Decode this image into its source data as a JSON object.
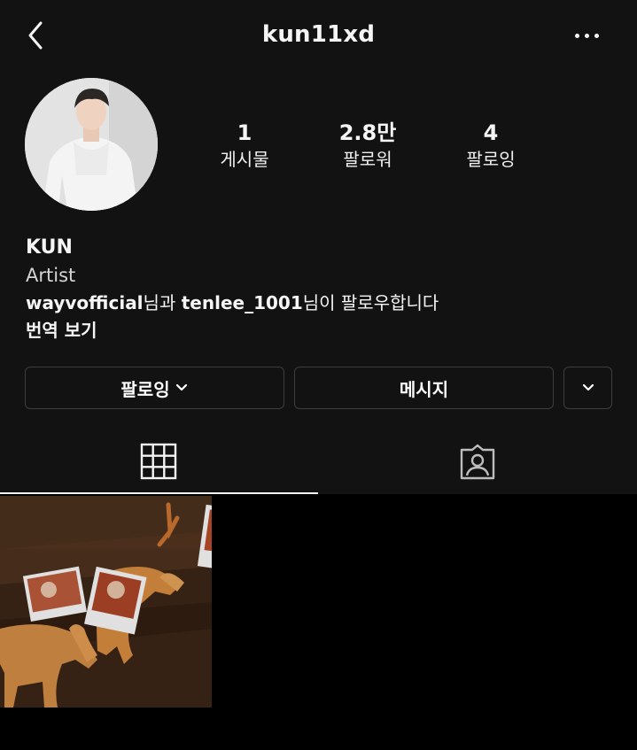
{
  "header": {
    "username": "kun11xd",
    "back_icon": "chevron-left-icon",
    "more_icon": "more-horizontal-icon"
  },
  "profile": {
    "stats": [
      {
        "value": "1",
        "label": "게시물"
      },
      {
        "value": "2.8만",
        "label": "팔로워"
      },
      {
        "value": "4",
        "label": "팔로잉"
      }
    ],
    "name": "KUN",
    "category": "Artist",
    "followed_by": {
      "user1": "wayvofficial",
      "mid": "님과 ",
      "user2": "tenlee_1001",
      "suffix": "님이 팔로우합니다"
    },
    "translate": "번역 보기"
  },
  "actions": {
    "following_label": "팔로잉",
    "message_label": "메시지",
    "suggest_icon": "chevron-down-icon"
  },
  "tabs": [
    {
      "name": "grid",
      "icon": "grid-icon",
      "active": true
    },
    {
      "name": "tagged",
      "icon": "tagged-person-icon",
      "active": false
    }
  ],
  "colors": {
    "background": "#121212",
    "text": "#f5f5f5",
    "button_border": "#3d3d3d"
  }
}
